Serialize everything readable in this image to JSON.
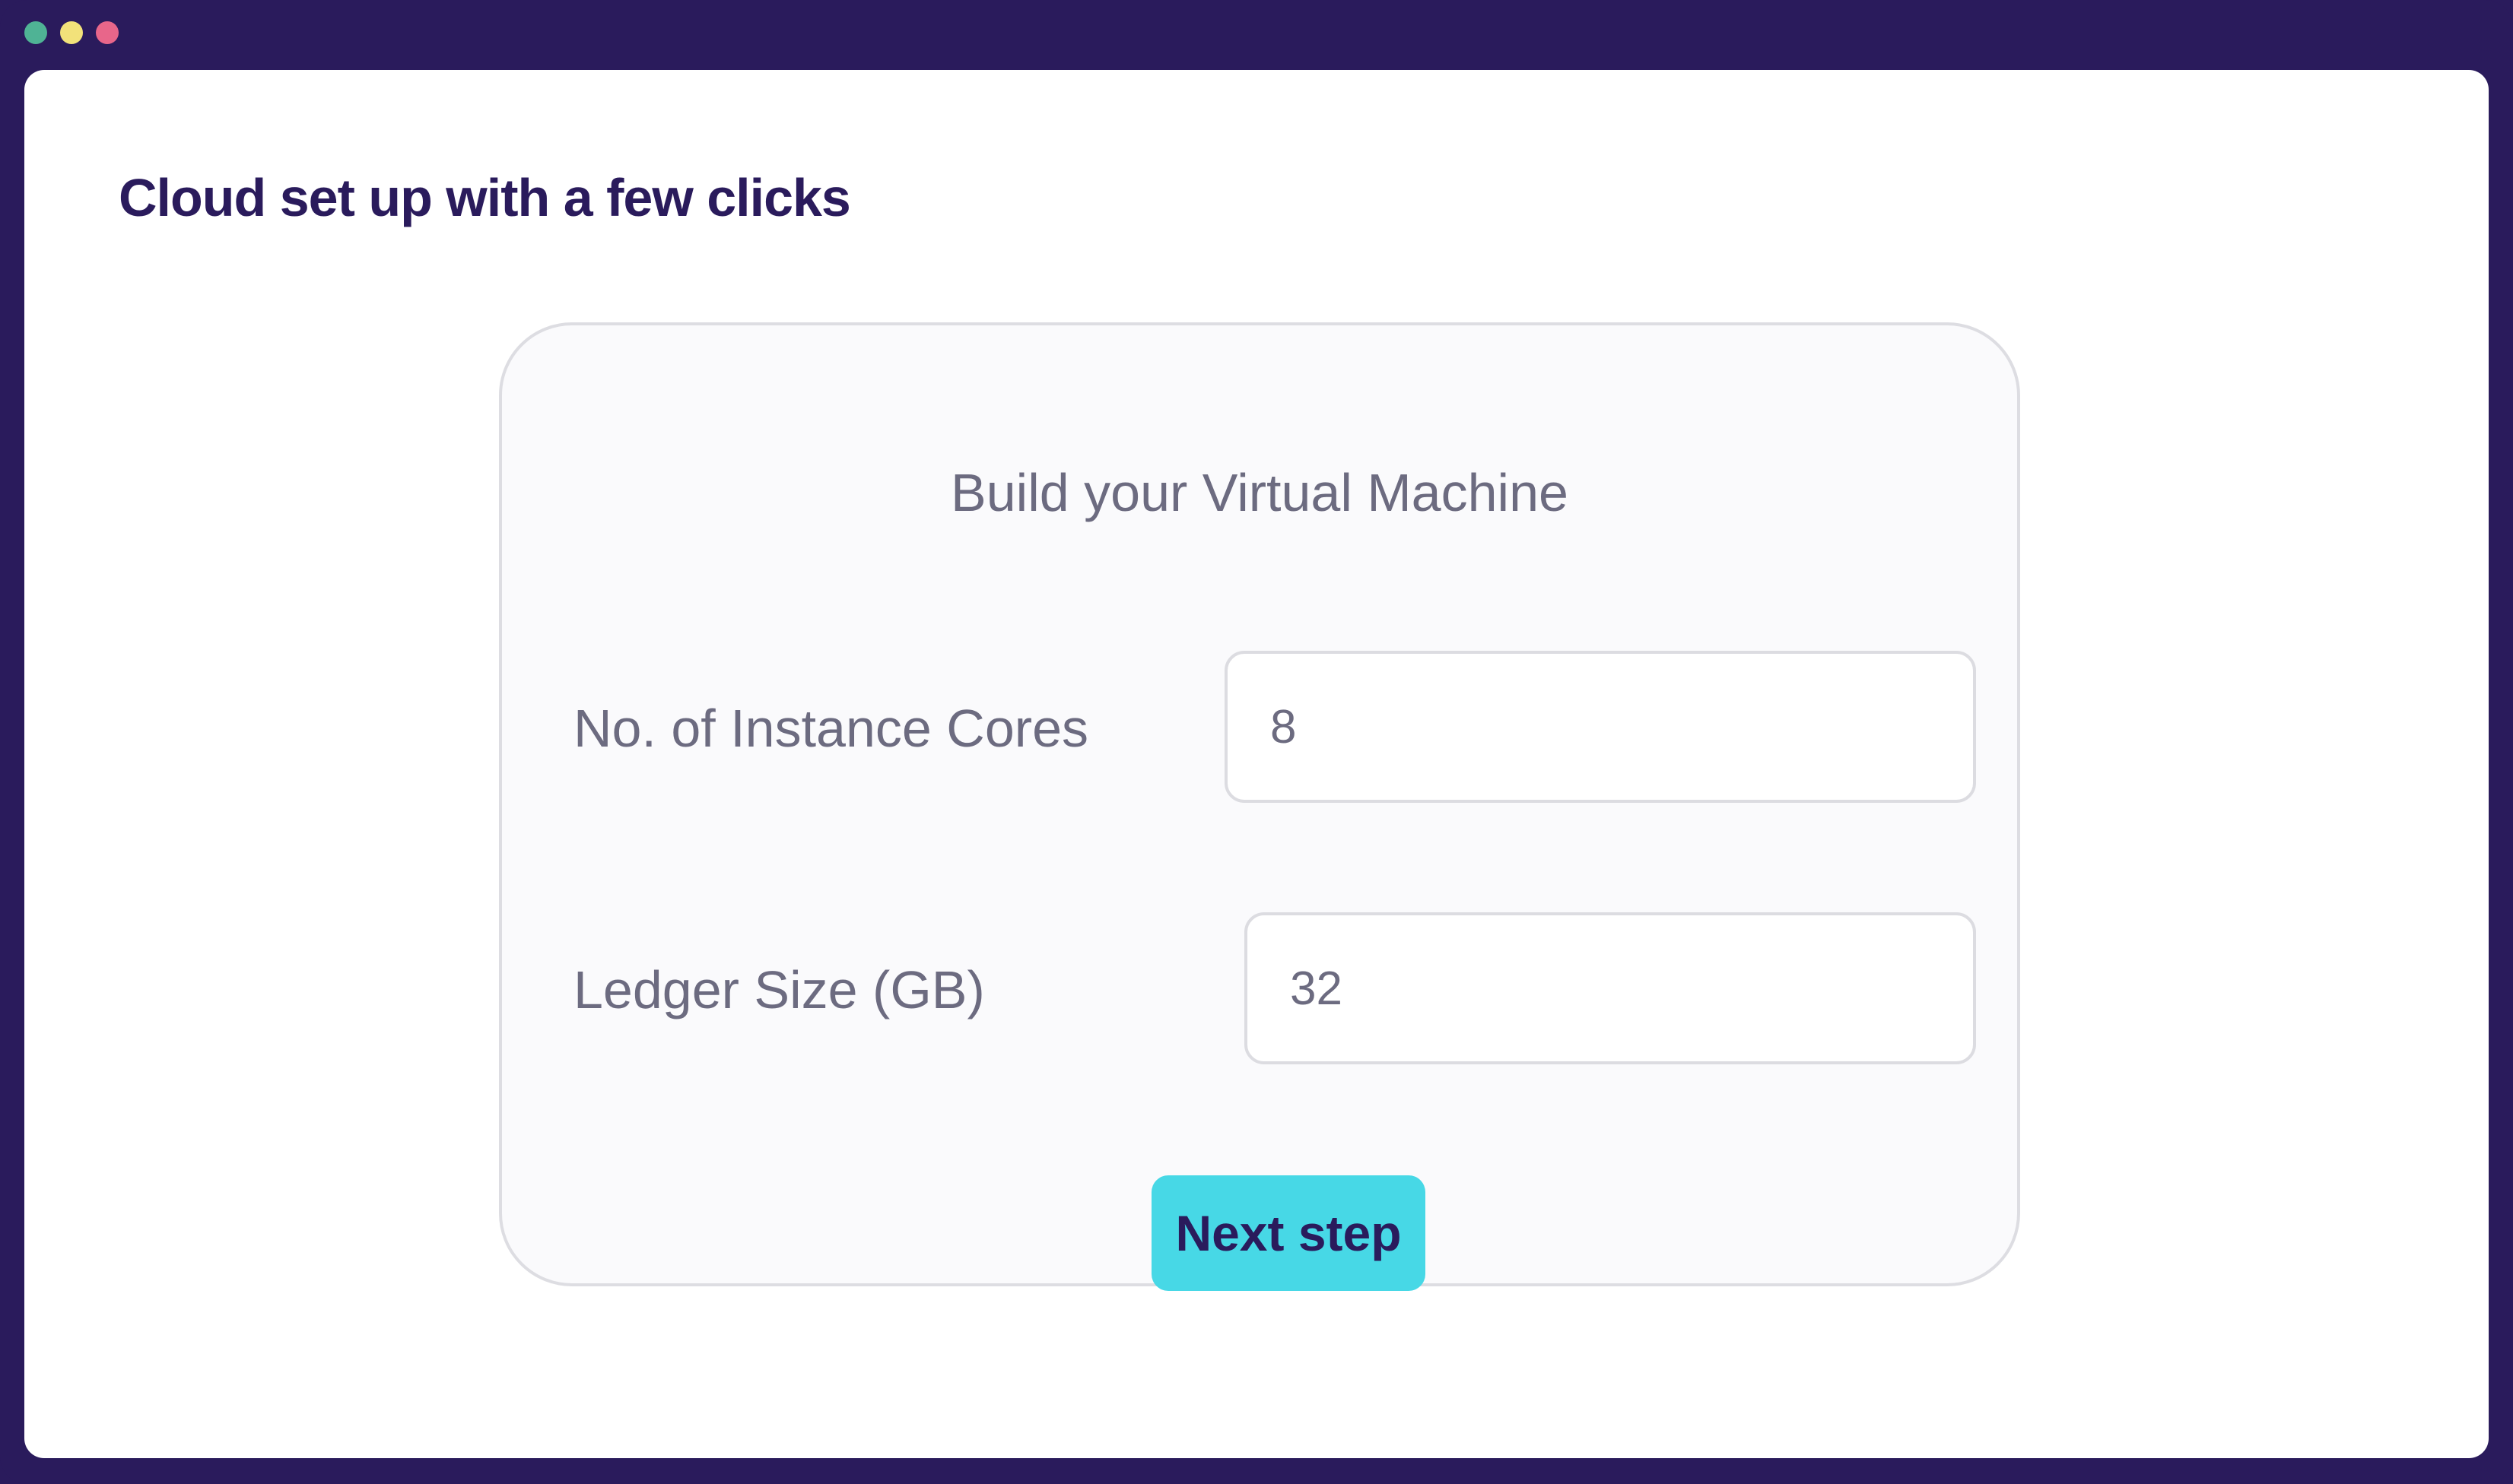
{
  "window": {
    "controls": [
      {
        "name": "green-dot",
        "color": "#4fb395"
      },
      {
        "name": "yellow-dot",
        "color": "#f2e27a"
      },
      {
        "name": "red-dot",
        "color": "#e8668a"
      }
    ],
    "frame_color": "#2a1b5c"
  },
  "page": {
    "title": "Cloud set up with a few clicks"
  },
  "form": {
    "title": "Build your Virtual Machine",
    "fields": [
      {
        "label": "No. of Instance Cores",
        "value": "8"
      },
      {
        "label": "Ledger Size (GB)",
        "value": "32"
      }
    ],
    "submit_label": "Next step",
    "accent_color": "#47d8e6"
  }
}
